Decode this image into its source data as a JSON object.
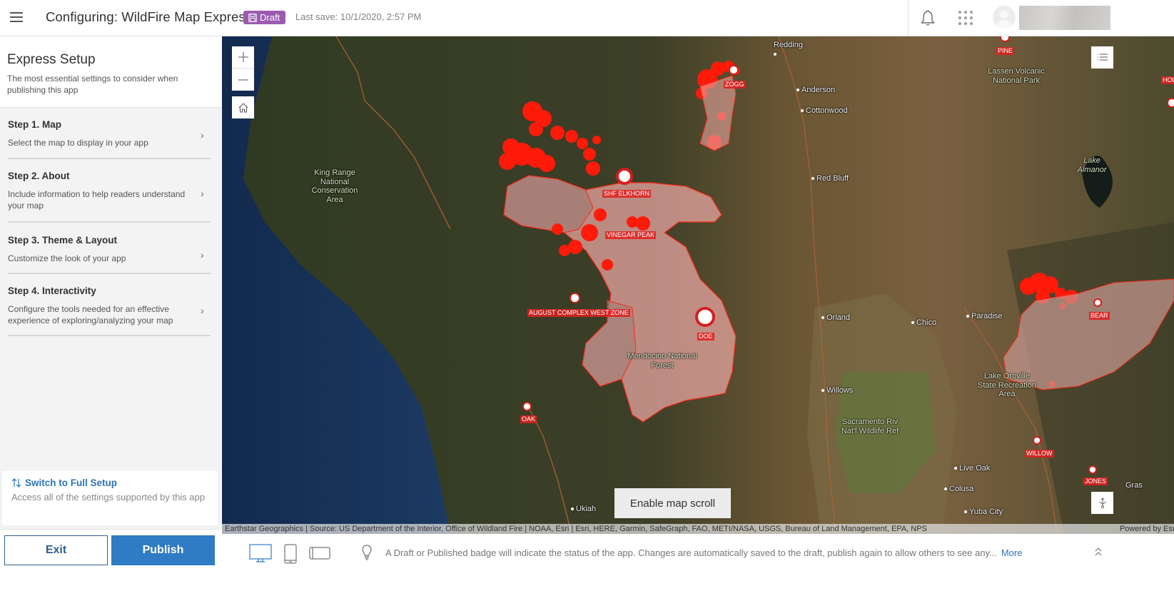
{
  "header": {
    "menu_icon": "hamburger-icon",
    "title": "Configuring: WildFire Map Express",
    "badge": {
      "icon": "save-icon",
      "label": "Draft",
      "color": "#9b5ab0"
    },
    "last_save": "Last save: 10/1/2020, 2:57 PM",
    "notifications_icon": "bell-icon",
    "apps_icon": "app-launcher-icon",
    "avatar_icon": "user-avatar-icon"
  },
  "sidebar": {
    "title": "Express Setup",
    "subtitle": "The most essential settings to consider when publishing this app",
    "steps": [
      {
        "title": "Step 1. Map",
        "description": "Select the map to display in your app"
      },
      {
        "title": "Step 2. About",
        "description": "Include information to help readers understand your map"
      },
      {
        "title": "Step 3. Theme & Layout",
        "description": "Customize the look of your app"
      },
      {
        "title": "Step 4. Interactivity",
        "description": "Configure the tools needed for an effective experience of exploring/analyzing your map"
      }
    ],
    "full_setup": {
      "link": "Switch to Full Setup",
      "description": "Access all of the settings supported by this app"
    },
    "exit_label": "Exit",
    "publish_label": "Publish",
    "accent_color": "#2f7bc4"
  },
  "map": {
    "controls": {
      "zoom_in": "plus-icon",
      "zoom_out": "minus-icon",
      "home": "home-icon",
      "layers": "layer-list-icon",
      "locate": "locate-icon"
    },
    "cities": [
      "Redding",
      "Anderson",
      "Cottonwood",
      "Red Bluff",
      "Orland",
      "Chico",
      "Paradise",
      "Willows",
      "Live Oak",
      "Colusa",
      "Yuba City",
      "Ukiah"
    ],
    "parks": [
      "King Range National Conservation Area",
      "Lassen Volcanic National Park",
      "Lake Almanor",
      "Mendocino National Forest",
      "Lake Oroville State Recreation Area",
      "Sacramento Riv Nat'l Wildlife Ref"
    ],
    "fires": [
      "ZOGG",
      "PINE",
      "HOLLO",
      "SHF ELKHORN",
      "VINEGAR PEAK",
      "AUGUST COMPLEX WEST ZONE",
      "DOE",
      "OAK",
      "BEAR",
      "WILLOW",
      "JONES"
    ],
    "other_labels": {
      "grass": "Gras"
    },
    "scroll_button": "Enable map scroll",
    "attribution": "Earthstar Geographics | Source: US Department of the Interior, Office of Wildland Fire | NOAA, Esri | Esri, HERE, Garmin, SafeGraph, FAO, METI/NASA, USGS, Bureau of Land Management, EPA, NPS",
    "powered_by": "Powered by Esri",
    "fire_color": "#ff1a0a"
  },
  "bottom_bar": {
    "devices": [
      "desktop-icon",
      "mobile-icon",
      "tablet-icon"
    ],
    "active_device": "desktop",
    "tip_icon": "lightbulb-icon",
    "tip": "A Draft or Published badge will indicate the status of the app. Changes are automatically saved to the draft, publish again to allow others to see any...",
    "more_label": "More",
    "collapse_icon": "chevron-double-up-icon"
  }
}
